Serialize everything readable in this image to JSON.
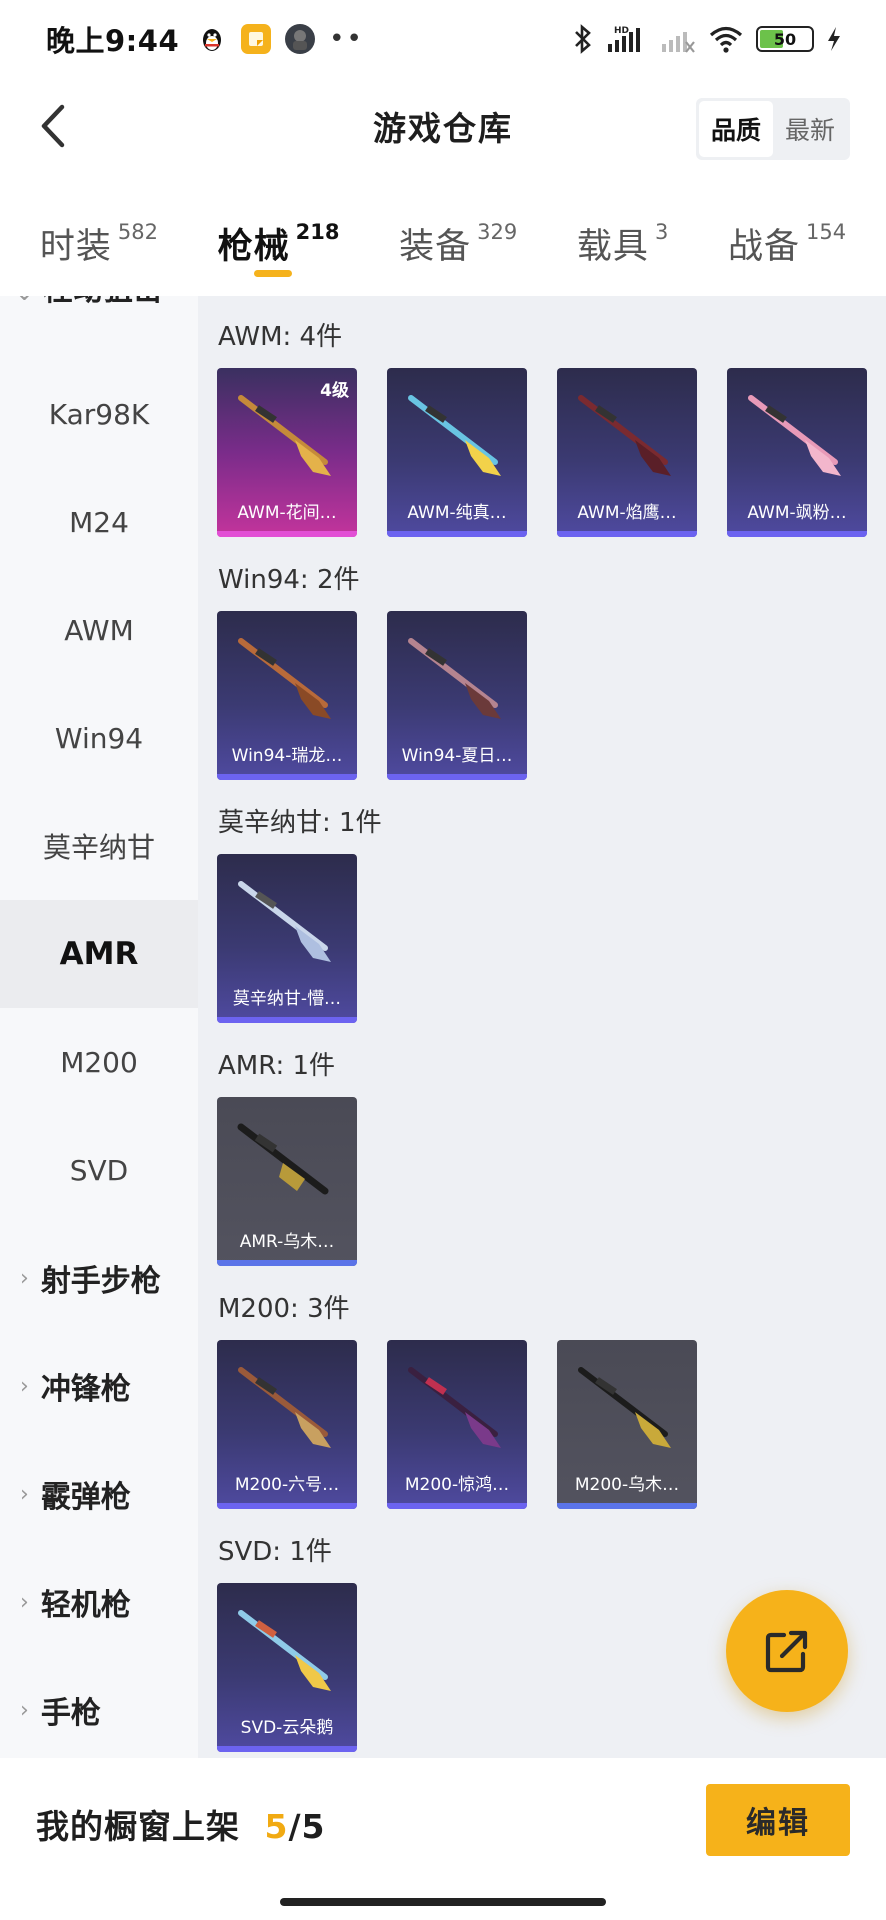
{
  "status_bar": {
    "time": "晚上9:44",
    "battery": "50",
    "hd_label": "HD"
  },
  "header": {
    "title": "游戏仓库",
    "sort_options": [
      "品质",
      "最新"
    ],
    "sort_selected": "品质"
  },
  "category_tabs": [
    {
      "label": "时装",
      "count": "582",
      "active": false
    },
    {
      "label": "枪械",
      "count": "218",
      "active": true
    },
    {
      "label": "装备",
      "count": "329",
      "active": false
    },
    {
      "label": "载具",
      "count": "3",
      "active": false
    },
    {
      "label": "战备",
      "count": "154",
      "active": false
    }
  ],
  "sidebar": {
    "partial_group": "栓动狙击",
    "items": [
      "Kar98K",
      "M24",
      "AWM",
      "Win94",
      "莫辛纳甘",
      "AMR",
      "M200",
      "SVD"
    ],
    "active_item": "AMR",
    "groups": [
      "射手步枪",
      "冲锋枪",
      "霰弹枪",
      "轻机枪",
      "手枪"
    ]
  },
  "sections": [
    {
      "title": "AWM: 4件",
      "items": [
        {
          "name": "AWM-花间…",
          "level": "4级",
          "tier": "gold"
        },
        {
          "name": "AWM-纯真…",
          "tier": "purple"
        },
        {
          "name": "AWM-焰鹰…",
          "tier": "purple"
        },
        {
          "name": "AWM-飒粉…",
          "tier": "purple"
        }
      ]
    },
    {
      "title": "Win94: 2件",
      "items": [
        {
          "name": "Win94-瑞龙…",
          "tier": "purple"
        },
        {
          "name": "Win94-夏日…",
          "tier": "purple"
        }
      ]
    },
    {
      "title": "莫辛纳甘: 1件",
      "items": [
        {
          "name": "莫辛纳甘-懵…",
          "tier": "purple"
        }
      ]
    },
    {
      "title": "AMR: 1件",
      "items": [
        {
          "name": "AMR-乌木…",
          "tier": "gray"
        }
      ]
    },
    {
      "title": "M200: 3件",
      "items": [
        {
          "name": "M200-六号…",
          "tier": "purple"
        },
        {
          "name": "M200-惊鸿…",
          "tier": "purple"
        },
        {
          "name": "M200-乌木…",
          "tier": "gray"
        }
      ]
    },
    {
      "title": "SVD: 1件",
      "items": [
        {
          "name": "SVD-云朵鹅",
          "tier": "purple"
        }
      ]
    }
  ],
  "bottom_bar": {
    "showcase_label": "我的橱窗上架",
    "showcase_current": "5",
    "showcase_sep": "/",
    "showcase_total": "5",
    "edit_label": "编辑"
  },
  "colors": {
    "accent": "#f6b21a",
    "sidebar_bg": "#f7f8fa",
    "content_bg": "#eef0f4",
    "purple_tier": "#4f4aa0",
    "gold_tier": "#c4349c",
    "gray_tier": "#53535f"
  },
  "icons": {
    "back": "chevron-left-icon",
    "fab": "share-external-icon",
    "bluetooth": "bluetooth-icon",
    "wifi": "wifi-icon",
    "signal": "signal-icon",
    "charging": "lightning-icon"
  }
}
